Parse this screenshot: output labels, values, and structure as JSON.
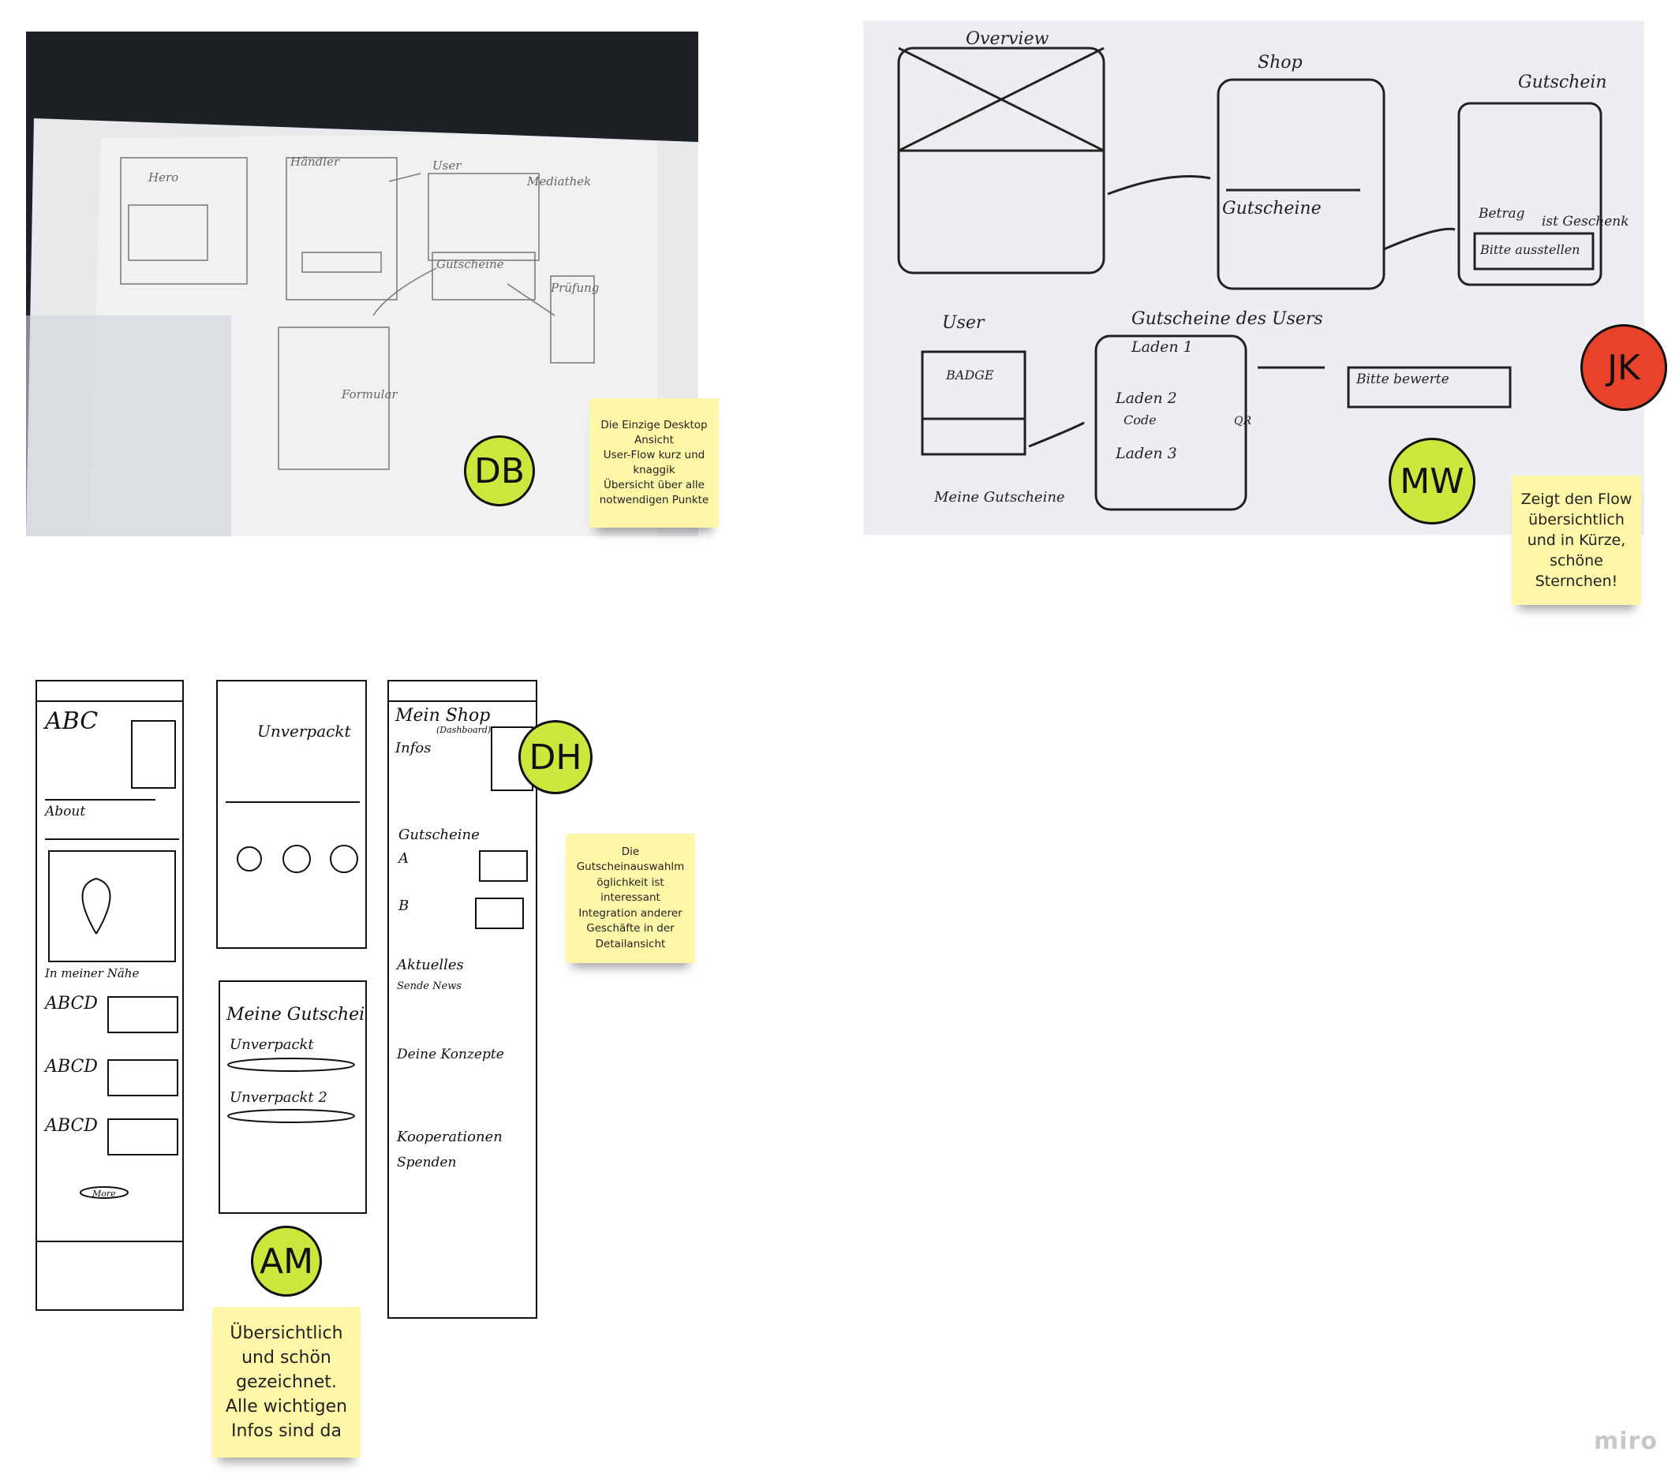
{
  "board": {
    "logo": "miro"
  },
  "colors": {
    "sticky": "#fff7a8",
    "badge_green": "#cde63c",
    "badge_red": "#e8432a"
  },
  "reviews": [
    {
      "initials": "DB",
      "note": "Die Einzige Desktop\nAnsicht\nUser-Flow kurz und\nknaggik\nÜbersicht über alle\nnotwendigen Punkte"
    },
    {
      "initials": "JK"
    },
    {
      "initials": "MW",
      "note": "Zeigt den Flow\nübersichtlich\nund in Kürze,\nschöne\nSternchen!"
    },
    {
      "initials": "DH",
      "note": "Die\nGutscheinauswahlm\nöglichkeit ist\ninteressant\nIntegration anderer\nGeschäfte in der\nDetailansicht"
    },
    {
      "initials": "AM",
      "note": "Übersichtlich\nund schön\ngezeichnet.\nAlle wichtigen\nInfos sind da"
    }
  ],
  "sketch_labels": {
    "db": [
      "Hero",
      "Händler",
      "User",
      "Mediathek",
      "Gutscheine",
      "Formular",
      "Prüfung"
    ],
    "jk": [
      "Overview",
      "Shop",
      "Gutschein",
      "Gutscheine",
      "Betrag",
      "ist Geschenk",
      "Bitte ausstellen",
      "User",
      "BADGE",
      "Meine Gutscheine",
      "Gutscheine des Users",
      "Laden 1",
      "Laden 2",
      "Laden 3",
      "Code",
      "QR",
      "Bitte bewerte"
    ],
    "am1": [
      "ABC",
      "About",
      "In meiner Nähe",
      "ABCD",
      "ABCD",
      "ABCD",
      "More"
    ],
    "am2": [
      "Unverpackt"
    ],
    "am3": [
      "Meine Gutscheine",
      "Unverpackt",
      "Unverpackt 2"
    ],
    "dh": [
      "Mein Shop",
      "(Dashboard)",
      "Infos",
      "Gutscheine",
      "A",
      "B",
      "Aktuelles",
      "Sende News",
      "Deine Konzepte",
      "Kooperationen",
      "Spenden"
    ]
  }
}
